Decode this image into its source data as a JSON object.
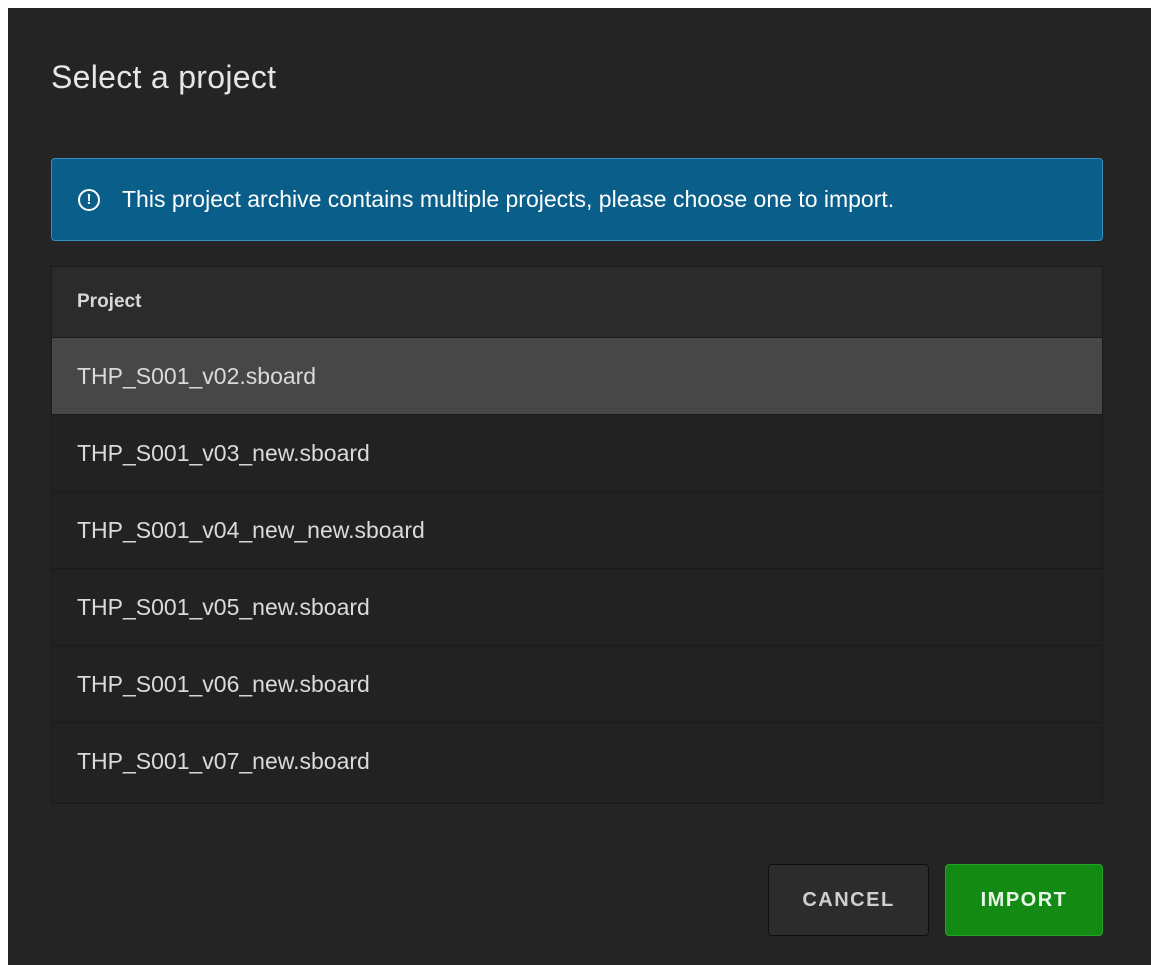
{
  "dialog": {
    "title": "Select a project"
  },
  "alert": {
    "icon": "info-circle-icon",
    "message": "This project archive contains multiple projects, please choose one to import."
  },
  "table": {
    "header": "Project",
    "rows": [
      {
        "name": "THP_S001_v02.sboard",
        "selected": true
      },
      {
        "name": "THP_S001_v03_new.sboard",
        "selected": false
      },
      {
        "name": "THP_S001_v04_new_new.sboard",
        "selected": false
      },
      {
        "name": "THP_S001_v05_new.sboard",
        "selected": false
      },
      {
        "name": "THP_S001_v06_new.sboard",
        "selected": false
      },
      {
        "name": "THP_S001_v07_new.sboard",
        "selected": false
      }
    ]
  },
  "buttons": {
    "cancel_label": "CANCEL",
    "import_label": "IMPORT"
  },
  "colors": {
    "background": "#242424",
    "alert": "#0a5f8a",
    "selected_row": "#474747",
    "primary": "#138a14"
  }
}
